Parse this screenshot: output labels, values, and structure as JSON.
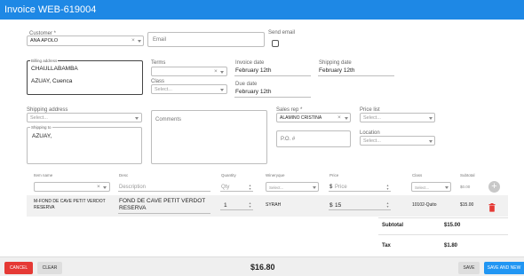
{
  "window": {
    "title": "Invoice WEB-619004"
  },
  "customer": {
    "label": "Customer *",
    "value": "ANA APOLO"
  },
  "email": {
    "placeholder": "Email"
  },
  "send_email": {
    "label": "Send email",
    "checked": false
  },
  "billing_address": {
    "label": "Billing address",
    "line1": "CHAULLABAMBA",
    "line2": "AZUAY, Cuenca"
  },
  "terms": {
    "label": "Terms",
    "value": ""
  },
  "class_field": {
    "label": "Class",
    "placeholder": "Select..."
  },
  "invoice_date": {
    "label": "Invoice date",
    "value": "February 12th"
  },
  "shipping_date": {
    "label": "Shipping date",
    "value": "February 12th"
  },
  "due_date": {
    "label": "Due date",
    "value": "February 12th"
  },
  "shipping_address": {
    "label": "Shipping address",
    "placeholder": "Select..."
  },
  "shipping_to": {
    "label": "Shipping to",
    "value": "AZUAY,"
  },
  "comments": {
    "placeholder": "Comments"
  },
  "sales_rep": {
    "label": "Sales rep *",
    "value": "ALAMINO CRISTINA"
  },
  "po": {
    "placeholder": "P.O. #"
  },
  "price_list": {
    "label": "Price list",
    "placeholder": "Select..."
  },
  "location": {
    "label": "Location",
    "placeholder": "Select..."
  },
  "table": {
    "headers": [
      "Item name",
      "Desc",
      "Quantity",
      "Wineryque",
      "Price",
      "Class",
      "Subtotal"
    ],
    "new_row": {
      "desc_placeholder": "Description",
      "qty_placeholder": "Qty",
      "winery_placeholder": "Select...",
      "price_placeholder": "Price",
      "currency": "$",
      "class_placeholder": "Select...",
      "subtotal": "$0.00"
    },
    "rows": [
      {
        "item_line1": "M-FOND DE CAVE PETIT VERDOT",
        "item_line2": "RESERVA",
        "desc_line1": "FOND DE CAVE PETIT VERDOT",
        "desc_line2": "RESERVA",
        "qty": "1",
        "winery": "SYRAH",
        "currency": "$",
        "price": "15",
        "class": "10102-Quito",
        "subtotal": "$15.00"
      }
    ]
  },
  "totals": {
    "subtotal_label": "Subtotal",
    "subtotal_value": "$15.00",
    "tax_label": "Tax",
    "tax_value": "$1.80"
  },
  "footer": {
    "cancel": "Cancel",
    "clear": "Clear",
    "total": "$16.80",
    "save": "Save",
    "save_new": "Save and New"
  },
  "colors": {
    "header": "#1e88e5",
    "cancel": "#e53935",
    "save_new": "#2196f3",
    "delete": "#e53935"
  }
}
